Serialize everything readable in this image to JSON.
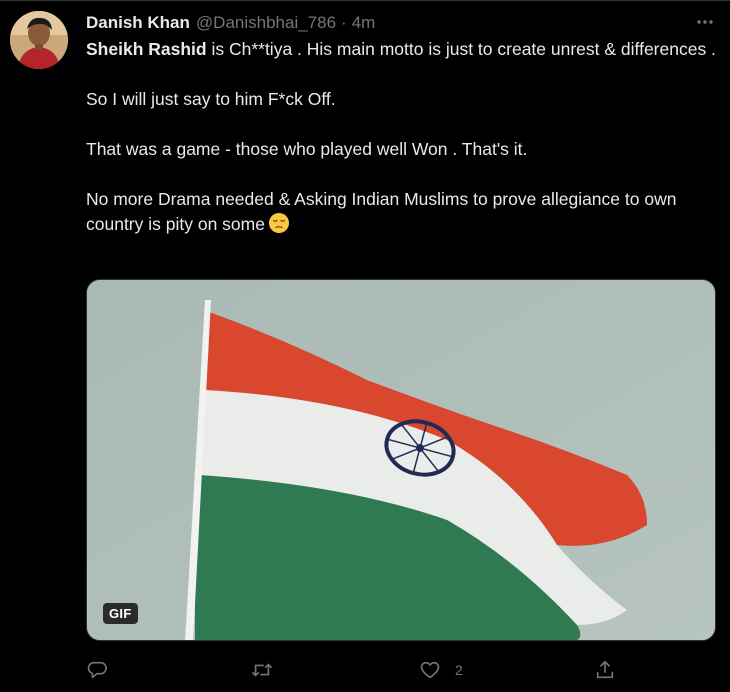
{
  "tweet": {
    "author": {
      "name": "Danish Khan",
      "handle": "@Danishbhai_786"
    },
    "separator": "·",
    "time": "4m",
    "text": {
      "line1_bold": "Sheikh Rashid",
      "line1_rest": " is Ch**tiya . His main motto is just to create unrest & differences .",
      "line2": "So I will just say to him F*ck Off.",
      "line3": "That was a game - those who played well Won . That's it.",
      "line4": "No more Drama needed & Asking Indian Muslims to prove allegiance to own country is pity on some"
    },
    "media": {
      "type_badge": "GIF"
    },
    "actions": {
      "reply_count": "",
      "retweet_count": "",
      "like_count": "2"
    }
  },
  "icons": {
    "more": "more-icon",
    "reply": "reply-icon",
    "retweet": "retweet-icon",
    "like": "heart-icon",
    "share": "share-icon",
    "emoji": "pensive-face-icon"
  },
  "colors": {
    "background": "#000000",
    "text_primary": "#e7e9ea",
    "text_secondary": "#71767b",
    "flag_saffron": "#d9472f",
    "flag_green": "#2f7a52",
    "chakra_navy": "#1f2a55"
  }
}
